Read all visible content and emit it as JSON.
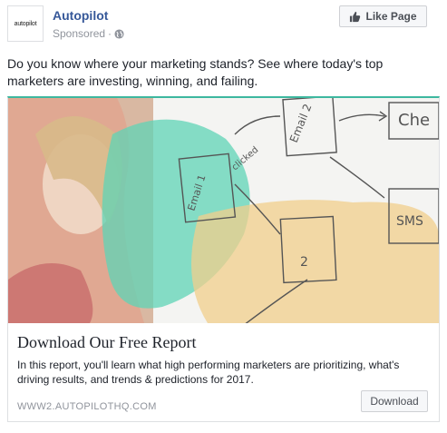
{
  "header": {
    "avatar_text": "autopilot",
    "page_name": "Autopilot",
    "sponsored_label": "Sponsored",
    "separator": "·",
    "like_button_label": "Like Page",
    "icons": {
      "audience": "globe-icon",
      "like": "thumbs-up-icon"
    }
  },
  "post": {
    "text": "Do you know where your marketing stands? See where today's top marketers are investing, winning, and failing."
  },
  "card": {
    "image_texts": [
      "Email 2",
      "Che",
      "SMS",
      "2",
      "Email 1",
      "clicked"
    ],
    "title": "Download Our Free Report",
    "description": "In this report, you'll learn what high performing marketers are prioritizing, what's driving results, and trends & predictions for 2017.",
    "domain": "WWW2.AUTOPILOTHQ.COM",
    "cta_label": "Download"
  },
  "colors": {
    "link_blue": "#365899",
    "accent_teal": "#3db89f",
    "muted_gray": "#90949c"
  }
}
